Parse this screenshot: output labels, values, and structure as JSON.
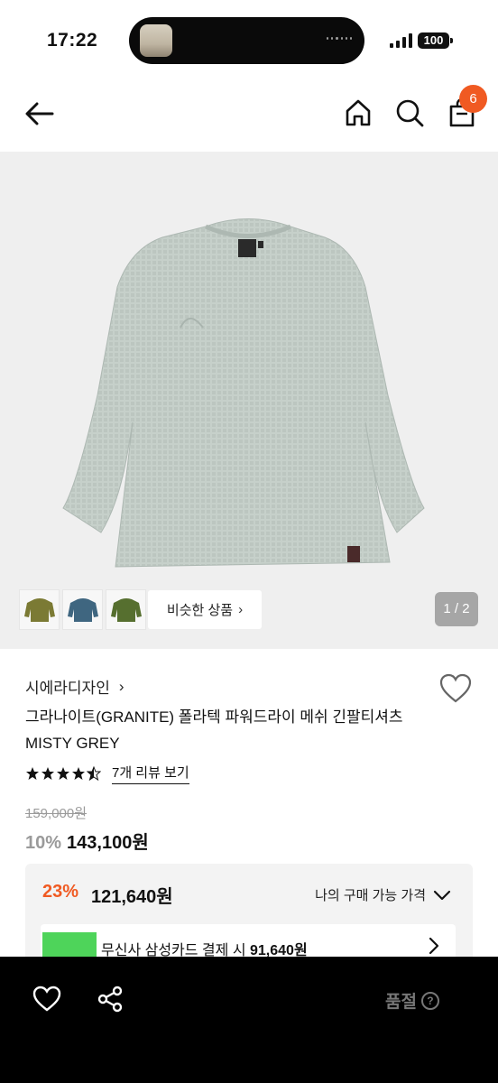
{
  "status_bar": {
    "time": "17:22",
    "battery": "100"
  },
  "nav": {
    "cart_count": "6"
  },
  "gallery": {
    "similar_label": "비슷한 상품",
    "pager": "1 / 2",
    "thumb_colors": [
      "#7b7a34",
      "#3f6680",
      "#566f2f"
    ],
    "main_color": "#c5cfc9"
  },
  "product": {
    "brand": "시에라디자인",
    "title": "그라나이트(GRANITE) 폴라텍 파워드라이 메쉬 긴팔티셔츠 MISTY GREY",
    "rating": 4.5,
    "review_link": "7개 리뷰 보기",
    "original_price": "159,000원",
    "discount_rate": "10%",
    "sale_price": "143,100원"
  },
  "benefit": {
    "rate": "23%",
    "price": "121,640원",
    "my_price_label": "나의 구매 가능 가격",
    "card_text_prefix": "무신사 삼성카드 결제 시",
    "card_price": "91,640원"
  },
  "bottom": {
    "soldout_label": "품절",
    "help_glyph": "?"
  },
  "colors": {
    "accent": "#f05a22",
    "text": "#111111",
    "muted": "#9a9a9a"
  }
}
